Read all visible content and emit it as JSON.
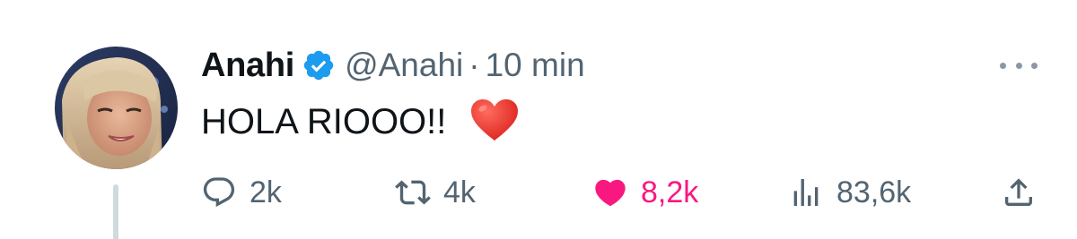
{
  "tweet": {
    "author_name": "Anahi",
    "handle": "@Anahi",
    "separator": "·",
    "timestamp": "10 min",
    "text": "HOLA RIOOO!!",
    "verified": true
  },
  "actions": {
    "replies": "2k",
    "retweets": "4k",
    "likes": "8,2k",
    "views": "83,6k"
  },
  "icons": {
    "avatar": "avatar",
    "verified": "verified-badge-icon",
    "more": "more-options-icon",
    "emoji": "red-heart-emoji",
    "reply": "reply-icon",
    "retweet": "retweet-icon",
    "like": "like-heart-icon",
    "views": "views-icon",
    "share": "share-icon"
  },
  "colors": {
    "text_primary": "#0f1419",
    "text_secondary": "#536471",
    "verified_blue": "#1d9bf0",
    "like_pink": "#f91880",
    "thread_line": "#cfd9de"
  }
}
